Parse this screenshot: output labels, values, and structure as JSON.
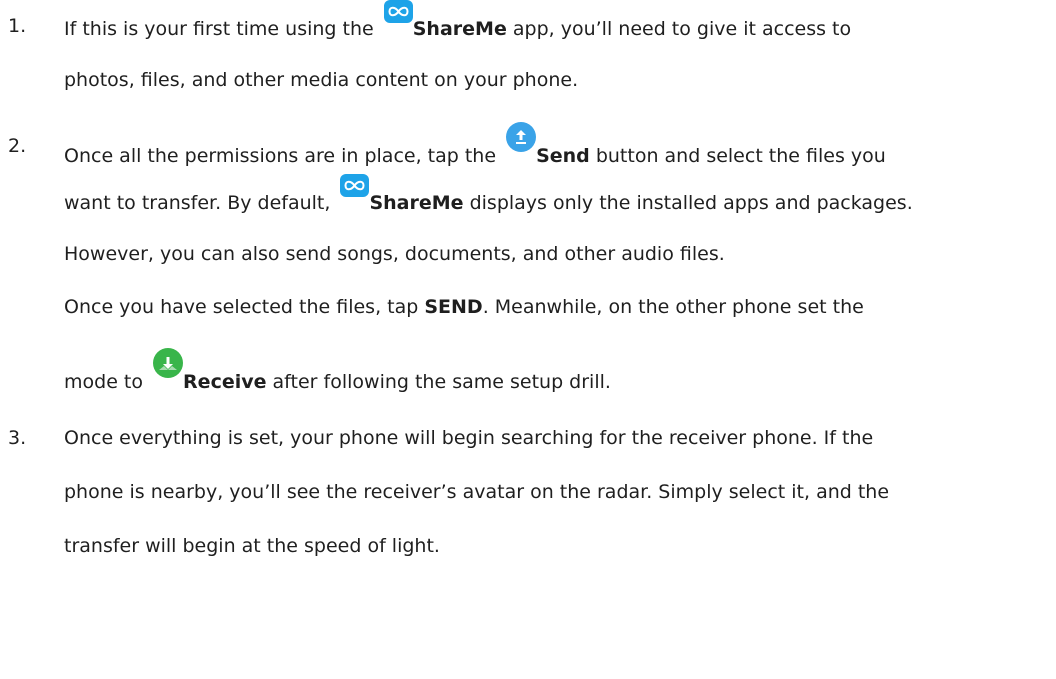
{
  "steps": [
    {
      "number": "1.",
      "lines": [
        {
          "pre": "If this is your first time using the ",
          "icon": "shareme-icon",
          "bold": "ShareMe",
          "post": " app, you’ll need to give it access to"
        },
        {
          "text": "photos, files, and other media content on your phone."
        }
      ]
    },
    {
      "number": "2.",
      "lines": [
        {
          "pre": "Once all the permissions are in place, tap the ",
          "icon": "send-icon",
          "bold": "Send",
          "post": " button and select the files you"
        },
        {
          "pre": "want to transfer. By default, ",
          "icon": "shareme-icon",
          "bold": "ShareMe",
          "post": " displays only the installed apps and packages."
        },
        {
          "text": "However, you can also send songs, documents, and other audio files."
        },
        {
          "pre": "Once you have selected the files, tap ",
          "bold": "SEND",
          "post": ". Meanwhile, on the other phone set the"
        },
        {
          "pre": "mode to ",
          "icon": "receive-icon",
          "bold": "Receive",
          "post": " after following the same setup drill."
        }
      ]
    },
    {
      "number": "3.",
      "lines": [
        {
          "text": "Once everything is set, your phone will begin searching for the receiver phone. If the"
        },
        {
          "text": "phone is nearby, you’ll see the receiver’s avatar on the radar. Simply select it, and the"
        },
        {
          "text": "transfer will begin at the speed of light."
        }
      ]
    }
  ],
  "colors": {
    "shareme": "#1ea3e8",
    "send": "#3aa3e8",
    "receive": "#39b54a",
    "text": "#1f1f1f"
  }
}
